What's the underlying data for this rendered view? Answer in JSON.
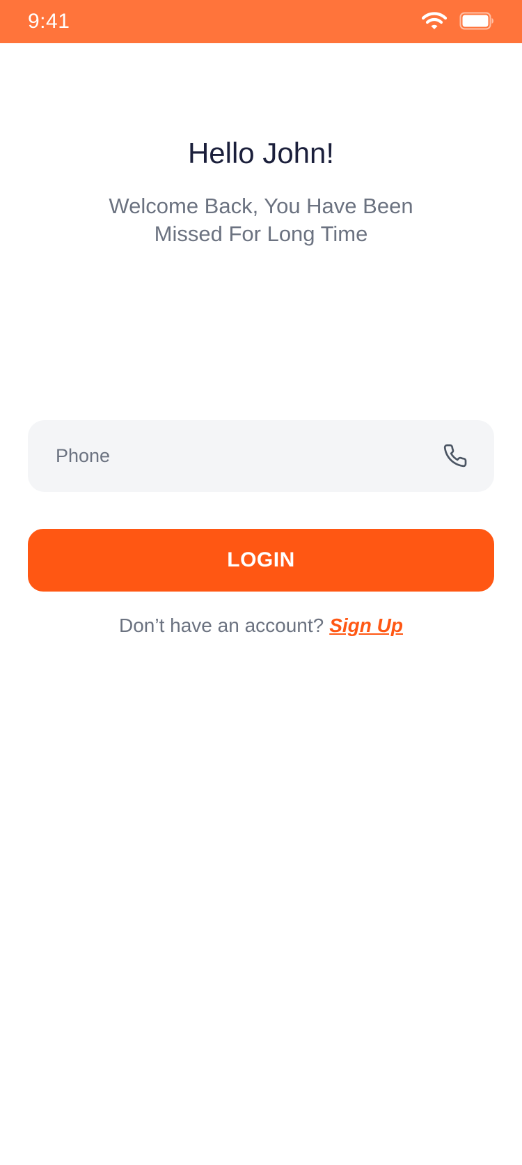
{
  "status_bar": {
    "time": "9:41",
    "background_color": "#FF743B",
    "icons": [
      "wifi-icon",
      "battery-icon"
    ]
  },
  "header": {
    "greeting": "Hello John!",
    "subtitle": "Welcome Back, You Have Been Missed For Long Time"
  },
  "form": {
    "phone": {
      "placeholder": "Phone",
      "value": "",
      "icon": "phone-icon"
    },
    "login_label": "LOGIN",
    "accent_color": "#FF5713"
  },
  "footer": {
    "prompt": "Don’t have an account?",
    "signup_label": "Sign Up"
  }
}
